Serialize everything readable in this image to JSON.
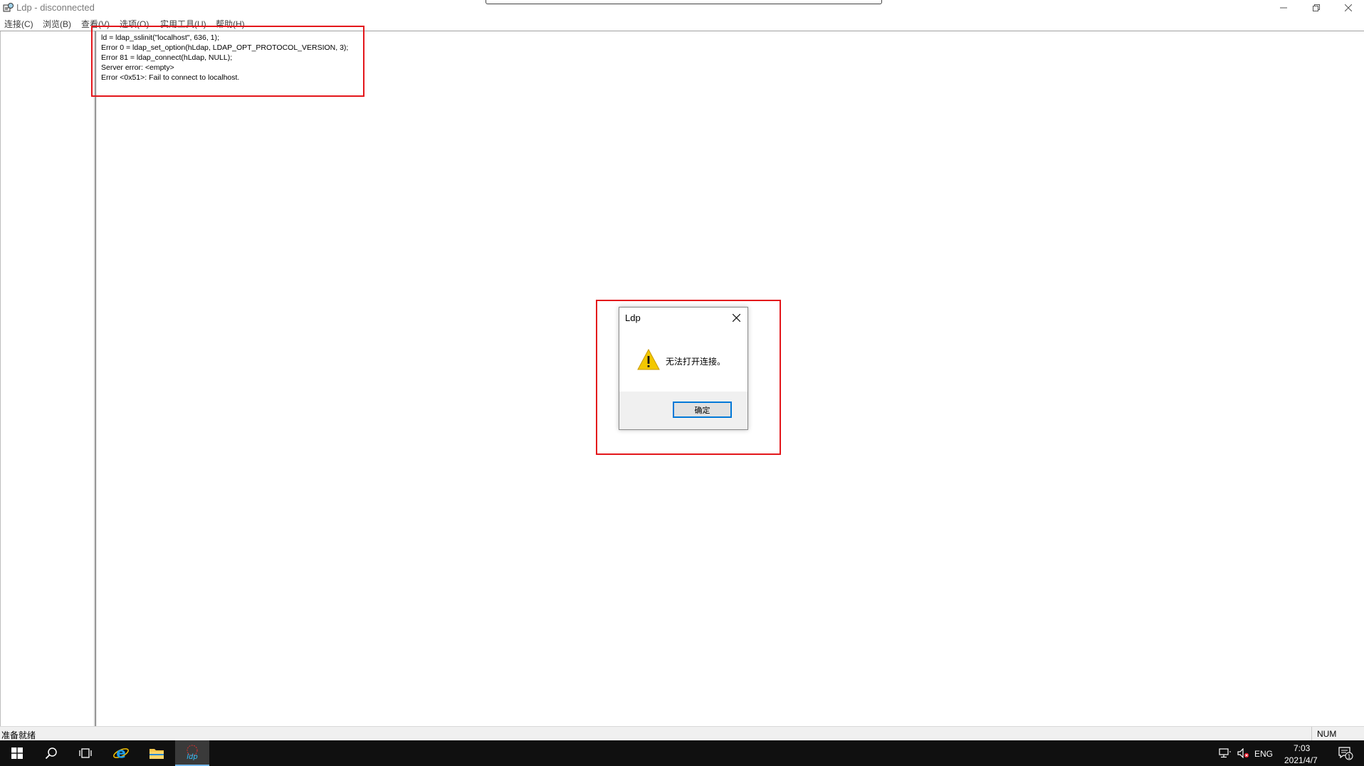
{
  "window": {
    "title": "Ldp - disconnected",
    "icon": "ldp-app-icon"
  },
  "menu": [
    {
      "label": "连接(C)"
    },
    {
      "label": "浏览(B)"
    },
    {
      "label": "查看(V)"
    },
    {
      "label": "选项(O)"
    },
    {
      "label": "实用工具(U)"
    },
    {
      "label": "帮助(H)"
    }
  ],
  "log": {
    "lines": [
      "ld = ldap_sslinit(\"localhost\", 636, 1);",
      "Error 0 = ldap_set_option(hLdap, LDAP_OPT_PROTOCOL_VERSION, 3);",
      "Error 81 = ldap_connect(hLdap, NULL);",
      "Server error: <empty>",
      "Error <0x51>: Fail to connect to localhost."
    ]
  },
  "dialog": {
    "title": "Ldp",
    "message": "无法打开连接。",
    "ok_label": "确定",
    "icon": "warning-icon"
  },
  "status": {
    "text": "准备就绪",
    "num": "NUM"
  },
  "taskbar": {
    "ldp_label": "ldp",
    "language": "ENG",
    "time": "7:03",
    "date": "2021/4/7",
    "notification_count": "1"
  },
  "colors": {
    "highlight": "#e3161b",
    "taskbar": "#101010",
    "accent": "#0078d7",
    "warning": "#f3c800"
  }
}
